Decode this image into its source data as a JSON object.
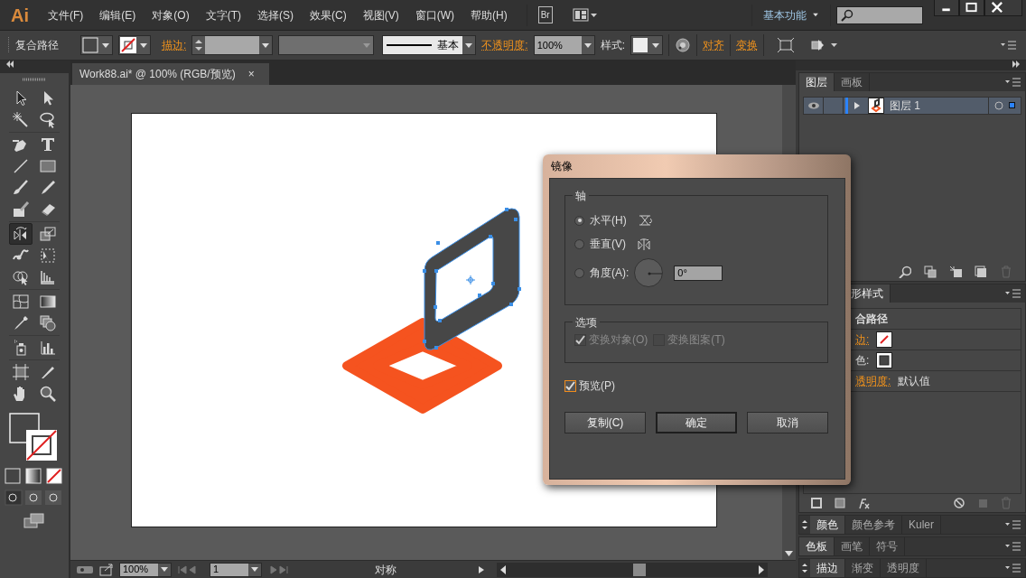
{
  "app": {
    "logo": "Ai",
    "menus": [
      "文件(F)",
      "编辑(E)",
      "对象(O)",
      "文字(T)",
      "选择(S)",
      "效果(C)",
      "视图(V)",
      "窗口(W)",
      "帮助(H)"
    ],
    "bridge": "Br",
    "workspace": "基本功能"
  },
  "control_bar": {
    "selection_label": "复合路径",
    "stroke_label": "描边:",
    "stroke_style": "基本",
    "opacity_label": "不透明度:",
    "opacity": "100%",
    "style_label": "样式:",
    "links": [
      "对齐",
      "变换"
    ]
  },
  "document": {
    "tab": "Work88.ai* @ 100% (RGB/预览)",
    "close": "×"
  },
  "tools": [
    {
      "kind": "selection",
      "selected": false
    },
    {
      "kind": "direct-selection",
      "selected": false
    },
    {
      "kind": "magic-wand",
      "selected": false
    },
    {
      "kind": "lasso",
      "selected": false
    },
    {
      "kind": "pen",
      "selected": false
    },
    {
      "kind": "type",
      "selected": false
    },
    {
      "kind": "line",
      "selected": false
    },
    {
      "kind": "rectangle",
      "selected": false
    },
    {
      "kind": "paintbrush",
      "selected": false
    },
    {
      "kind": "pencil",
      "selected": false
    },
    {
      "kind": "blob-brush",
      "selected": false
    },
    {
      "kind": "eraser",
      "selected": false
    },
    {
      "kind": "reflect",
      "selected": true
    },
    {
      "kind": "scale",
      "selected": false
    },
    {
      "kind": "warp",
      "selected": false
    },
    {
      "kind": "free-transform",
      "selected": false
    },
    {
      "kind": "shape-builder",
      "selected": false
    },
    {
      "kind": "perspective-grid",
      "selected": false
    },
    {
      "kind": "mesh",
      "selected": false
    },
    {
      "kind": "gradient",
      "selected": false
    },
    {
      "kind": "eyedropper",
      "selected": false
    },
    {
      "kind": "blend",
      "selected": false
    },
    {
      "kind": "symbol-sprayer",
      "selected": false
    },
    {
      "kind": "column-graph",
      "selected": false
    },
    {
      "kind": "artboard",
      "selected": false
    },
    {
      "kind": "slice",
      "selected": false
    },
    {
      "kind": "hand",
      "selected": false
    },
    {
      "kind": "zoom",
      "selected": false
    }
  ],
  "dialog": {
    "title": "镜像",
    "axis_group": "轴",
    "axes": [
      {
        "kind": "horizontal",
        "label": "水平(H)",
        "selected": true
      },
      {
        "kind": "vertical",
        "label": "垂直(V)",
        "selected": false
      },
      {
        "kind": "angle",
        "label": "角度(A):",
        "selected": false,
        "value": "0°"
      }
    ],
    "options_group": "选项",
    "options": [
      {
        "label": "变换对象(O)",
        "checked": true,
        "disabled": true
      },
      {
        "label": "变换图案(T)",
        "checked": false,
        "disabled": true
      }
    ],
    "preview": {
      "label": "预览(P)",
      "checked": true
    },
    "buttons": [
      {
        "label": "复制(C)",
        "default": false
      },
      {
        "label": "确定",
        "default": true
      },
      {
        "label": "取消",
        "default": false
      }
    ]
  },
  "layers_panel": {
    "tabs": [
      {
        "label": "图层",
        "selected": true
      },
      {
        "label": "画板",
        "selected": false
      }
    ],
    "layers": [
      {
        "name": "图层 1",
        "visible": true,
        "selected": true
      }
    ]
  },
  "appearance_panel": {
    "tab": "形样式",
    "title": "合路径",
    "rows": [
      {
        "kind": "stroke",
        "label": "边:"
      },
      {
        "kind": "fill",
        "label": "色:"
      },
      {
        "kind": "opacity",
        "label": "透明度:",
        "value": "默认值"
      }
    ]
  },
  "dock_panels": [
    {
      "tabs": [
        {
          "label": "颜色",
          "selected": true
        },
        {
          "label": "颜色参考",
          "selected": false
        },
        {
          "label": "Kuler",
          "selected": false
        }
      ]
    },
    {
      "tabs": [
        {
          "label": "色板",
          "selected": true
        },
        {
          "label": "画笔",
          "selected": false
        },
        {
          "label": "符号",
          "selected": false
        }
      ]
    },
    {
      "tabs": [
        {
          "label": "描边",
          "selected": true
        },
        {
          "label": "渐变",
          "selected": false
        },
        {
          "label": "透明度",
          "selected": false
        }
      ]
    }
  ],
  "status_bar": {
    "zoom": "100%",
    "artboard": "1",
    "status": "对称"
  }
}
